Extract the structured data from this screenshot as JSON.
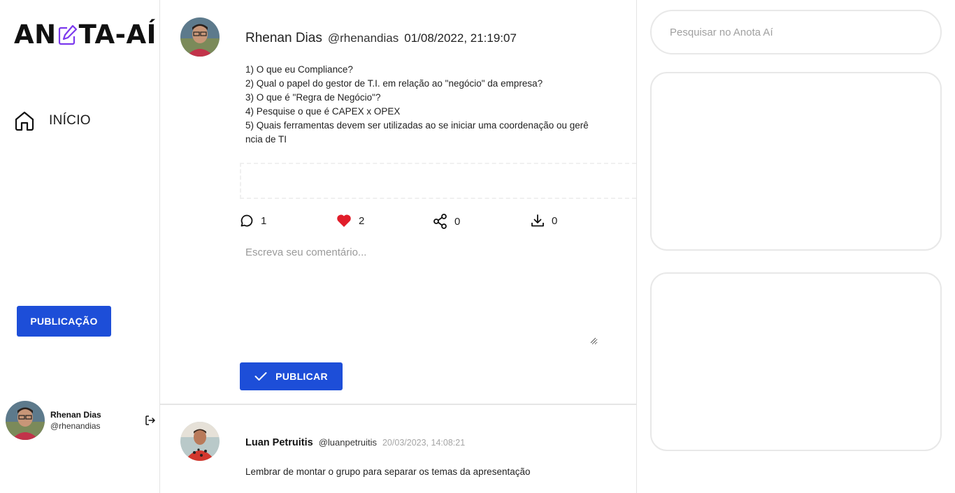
{
  "app": {
    "logo_left": "AN",
    "logo_right": "TA-AÍ",
    "brand_color": "#1d4ed8",
    "logo_icon": "edit-square-icon"
  },
  "sidebar": {
    "home_label": "INÍCIO",
    "home_icon": "home-icon",
    "publish_button": "PUBLICAÇÃO",
    "user": {
      "name": "Rhenan Dias",
      "handle": "@rhenandias",
      "logout_icon": "logout-icon"
    }
  },
  "post": {
    "author_name": "Rhenan Dias",
    "author_handle": "@rhenandias",
    "timestamp": "01/08/2022, 21:19:07",
    "lines": [
      "1) O que eu Compliance?",
      "2) Qual o papel do gestor de T.I. em relação ao \"negócio\" da empresa?",
      "3) O que é \"Regra de Negócio\"?",
      "4) Pesquise o que é CAPEX x OPEX",
      "5) Quais ferramentas devem ser utilizadas ao se iniciar uma coordenação ou gerê",
      "ncia de TI"
    ],
    "actions": {
      "comments": "1",
      "likes": "2",
      "shares": "0",
      "downloads": "0",
      "like_color": "#e11d2a"
    },
    "comment_placeholder": "Escreva seu comentário...",
    "publish_label": "PUBLICAR"
  },
  "post2": {
    "author_name": "Luan Petruitis",
    "author_handle": "@luanpetruitis",
    "timestamp": "20/03/2023, 14:08:21",
    "text": "Lembrar de montar o grupo para separar os temas da apresentação"
  },
  "search": {
    "placeholder": "Pesquisar no Anota Aí"
  }
}
